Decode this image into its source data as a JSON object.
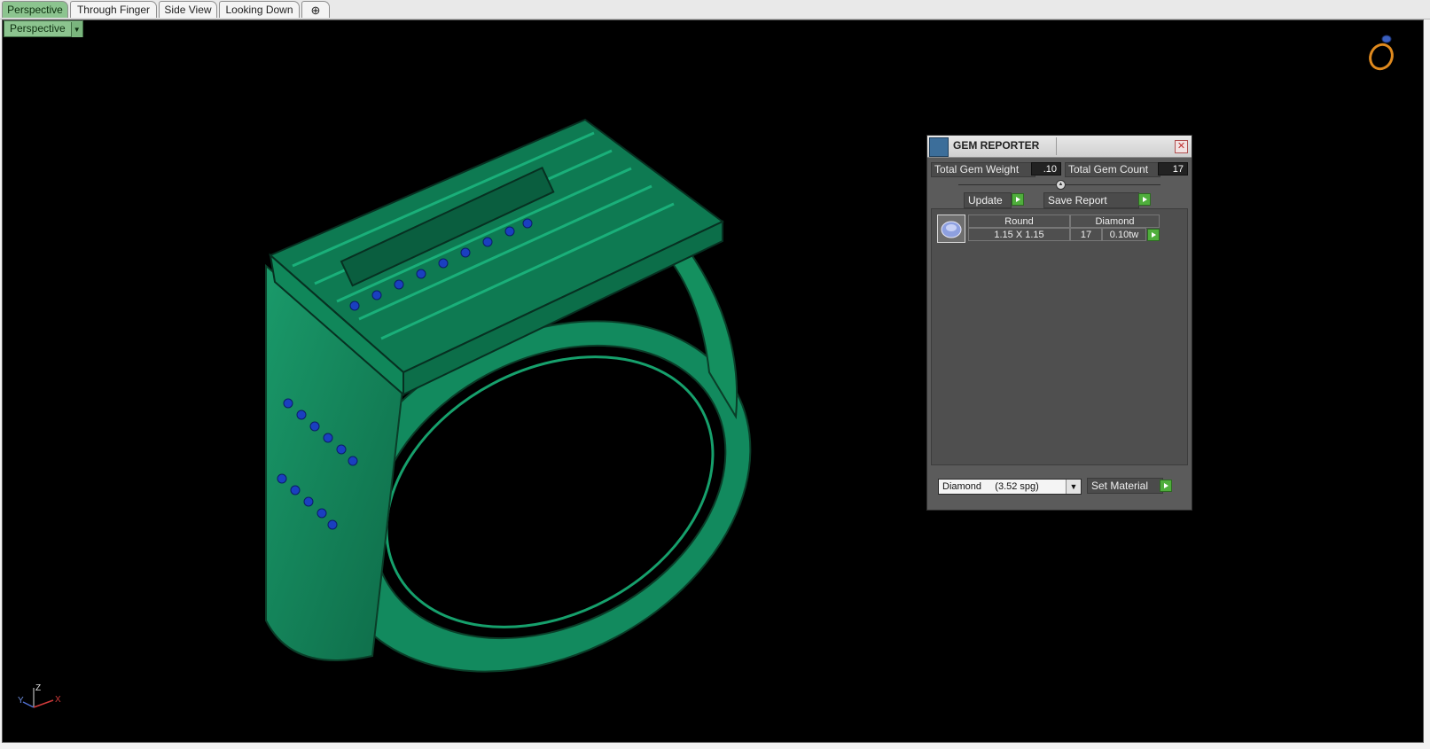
{
  "tabs": [
    "Perspective",
    "Through Finger",
    "Side View",
    "Looking Down"
  ],
  "add_tab_icon": "plus-icon",
  "view_dropdown": {
    "label": "Perspective",
    "icon": "chevron-down-icon"
  },
  "gem_reporter": {
    "title": "GEM REPORTER",
    "total_weight_label": "Total Gem Weight",
    "total_weight_value": ".10",
    "total_count_label": "Total Gem Count",
    "total_count_value": "17",
    "update_label": "Update",
    "save_report_label": "Save Report",
    "rows": [
      {
        "shape": "Round",
        "material": "Diamond",
        "size": "1.15 X 1.15",
        "count": "17",
        "weight": "0.10tw"
      }
    ],
    "material_select": "Diamond     (3.52 spg)",
    "set_material_label": "Set Material"
  },
  "axis": {
    "z": "Z",
    "y": "Y",
    "x": "X"
  },
  "colors": {
    "viewport_bg": "#000000",
    "model_green": "#15835b",
    "gem_blue": "#1a3fc0",
    "active_tab": "#8cc48f",
    "panel_bg": "#5b5b5b",
    "go_green": "#4fae3c"
  }
}
